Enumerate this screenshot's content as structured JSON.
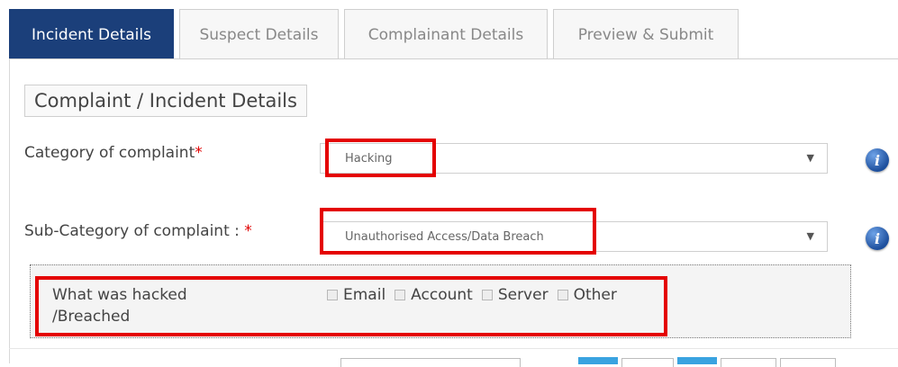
{
  "tabs": [
    {
      "label": "Incident Details",
      "active": true
    },
    {
      "label": "Suspect Details",
      "active": false
    },
    {
      "label": "Complainant Details",
      "active": false
    },
    {
      "label": "Preview & Submit",
      "active": false
    }
  ],
  "section": {
    "title": "Complaint / Incident Details"
  },
  "category": {
    "label": "Category of complaint",
    "required_mark": "*",
    "selected": "Hacking"
  },
  "subcategory": {
    "label": "Sub-Category of complaint : ",
    "required_mark": "*",
    "selected": "Unauthorised Access/Data Breach"
  },
  "hacked": {
    "label_line1": "What was hacked",
    "label_line2": "/Breached",
    "options": [
      "Email",
      "Account",
      "Server",
      "Other"
    ]
  },
  "icons": {
    "info": "info-icon",
    "dropdown": "dropdown-arrow-icon"
  },
  "colors": {
    "active_tab": "#1b3f7a",
    "highlight": "#e40000",
    "required": "#e00000",
    "info_icon": "#1d4f9d",
    "accent_blue": "#39a3e0"
  }
}
